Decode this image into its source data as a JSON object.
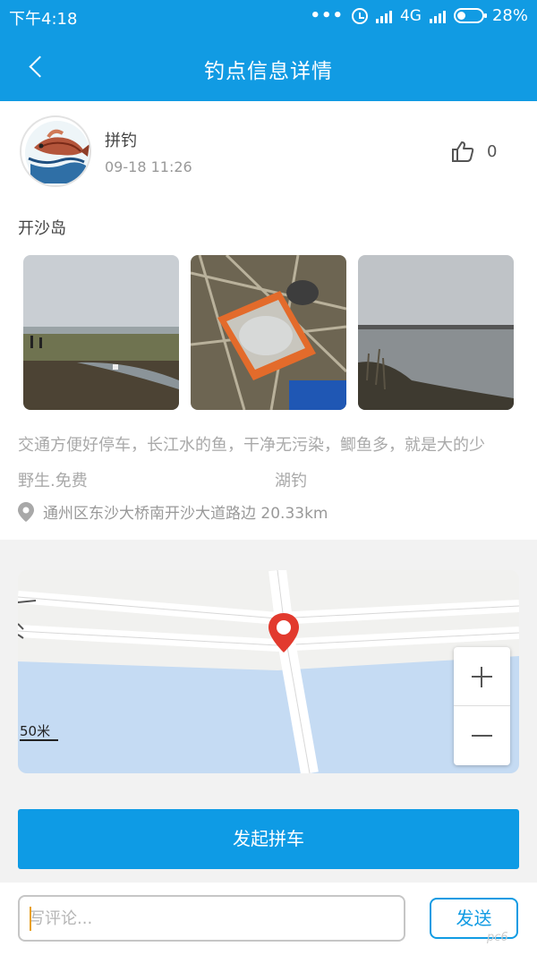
{
  "status_bar": {
    "time": "下午4:18",
    "network": "4G",
    "battery": "28%",
    "battery_level": 0.28
  },
  "navbar": {
    "title": "钓点信息详情",
    "back_icon": "chevron-left-icon"
  },
  "post": {
    "author": "拼钓",
    "date": "09-18 11:26",
    "like_count": "0",
    "place_name": "开沙岛",
    "description_line1": "交通方便好停车，长江水的鱼，干净无污染，鲫鱼多，就是大的少",
    "description_line2": "野生.免费",
    "fishing_type": "湖钓",
    "address": "通州区东沙大桥南开沙大道路边 20.33km",
    "photos": [
      "riverbank-photo",
      "fish-bucket-photo",
      "lake-photo"
    ]
  },
  "map": {
    "scale_label": "50米",
    "marker_icon": "location-marker-icon"
  },
  "actions": {
    "carpool_label": "发起拼车",
    "comment_placeholder": "写评论...",
    "send_label": "发送"
  },
  "watermark": "pc6"
}
